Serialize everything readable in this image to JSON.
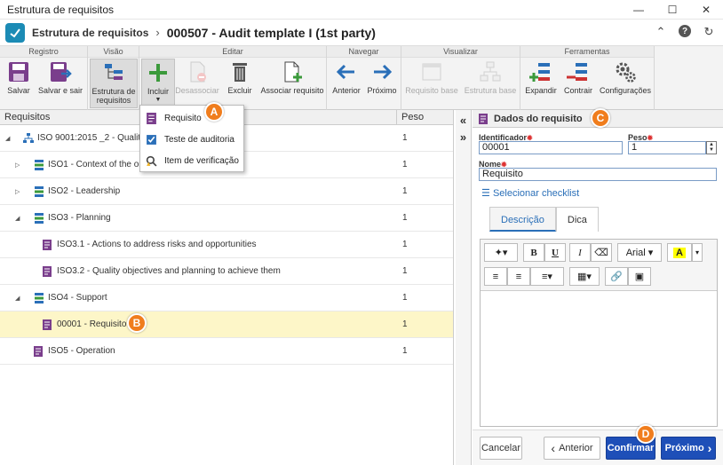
{
  "window": {
    "title": "Estrutura de requisitos"
  },
  "header": {
    "breadcrumb": "Estrutura de requisitos",
    "title": "000507 - Audit template I (1st party)"
  },
  "ribbon": {
    "groups": {
      "registro": "Registro",
      "visao": "Visão",
      "editar": "Editar",
      "navegar": "Navegar",
      "visualizar": "Visualizar",
      "ferramentas": "Ferramentas"
    },
    "buttons": {
      "salvar": "Salvar",
      "salvar_sair": "Salvar e sair",
      "estrutura_1": "Estrutura de",
      "estrutura_2": "requisitos",
      "incluir": "Incluir",
      "desassociar": "Desassociar",
      "excluir": "Excluir",
      "associar": "Associar requisito",
      "anterior": "Anterior",
      "proximo": "Próximo",
      "requisito_base": "Requisito base",
      "estrutura_base": "Estrutura base",
      "expandir": "Expandir",
      "contrair": "Contrair",
      "configuracoes": "Configurações"
    }
  },
  "dropdown": {
    "items": [
      "Requisito",
      "Teste de auditoria",
      "Item de verificação"
    ]
  },
  "tree": {
    "col_requisitos": "Requisitos",
    "col_peso": "Peso",
    "rows": [
      {
        "label": "ISO 9001:2015 _2 - Quality m",
        "peso": "1"
      },
      {
        "label": "ISO1 - Context of the orga",
        "peso": "1"
      },
      {
        "label": "ISO2 - Leadership",
        "peso": "1"
      },
      {
        "label": "ISO3 - Planning",
        "peso": "1"
      },
      {
        "label": "ISO3.1 - Actions to address risks and opportunities",
        "peso": "1"
      },
      {
        "label": "ISO3.2 - Quality objectives and planning to achieve them",
        "peso": "1"
      },
      {
        "label": "ISO4 - Support",
        "peso": "1"
      },
      {
        "label": "00001 - Requisito",
        "peso": "1"
      },
      {
        "label": "ISO5 - Operation",
        "peso": "1"
      }
    ]
  },
  "details": {
    "title": "Dados do requisito",
    "identificador_label": "Identificador",
    "identificador_value": "00001",
    "peso_label": "Peso",
    "peso_value": "1",
    "nome_label": "Nome",
    "nome_value": "Requisito",
    "checklist_link": "Selecionar checklist",
    "tab_descricao": "Descrição",
    "tab_dica": "Dica",
    "font_name": "Arial"
  },
  "footer": {
    "cancelar": "Cancelar",
    "anterior": "Anterior",
    "confirmar": "Confirmar",
    "proximo": "Próximo"
  },
  "markers": [
    "A",
    "B",
    "C",
    "D"
  ],
  "colors": {
    "accent": "#1e4fb8",
    "marker": "#f07d1d",
    "selected_row": "#fdf6c8"
  }
}
